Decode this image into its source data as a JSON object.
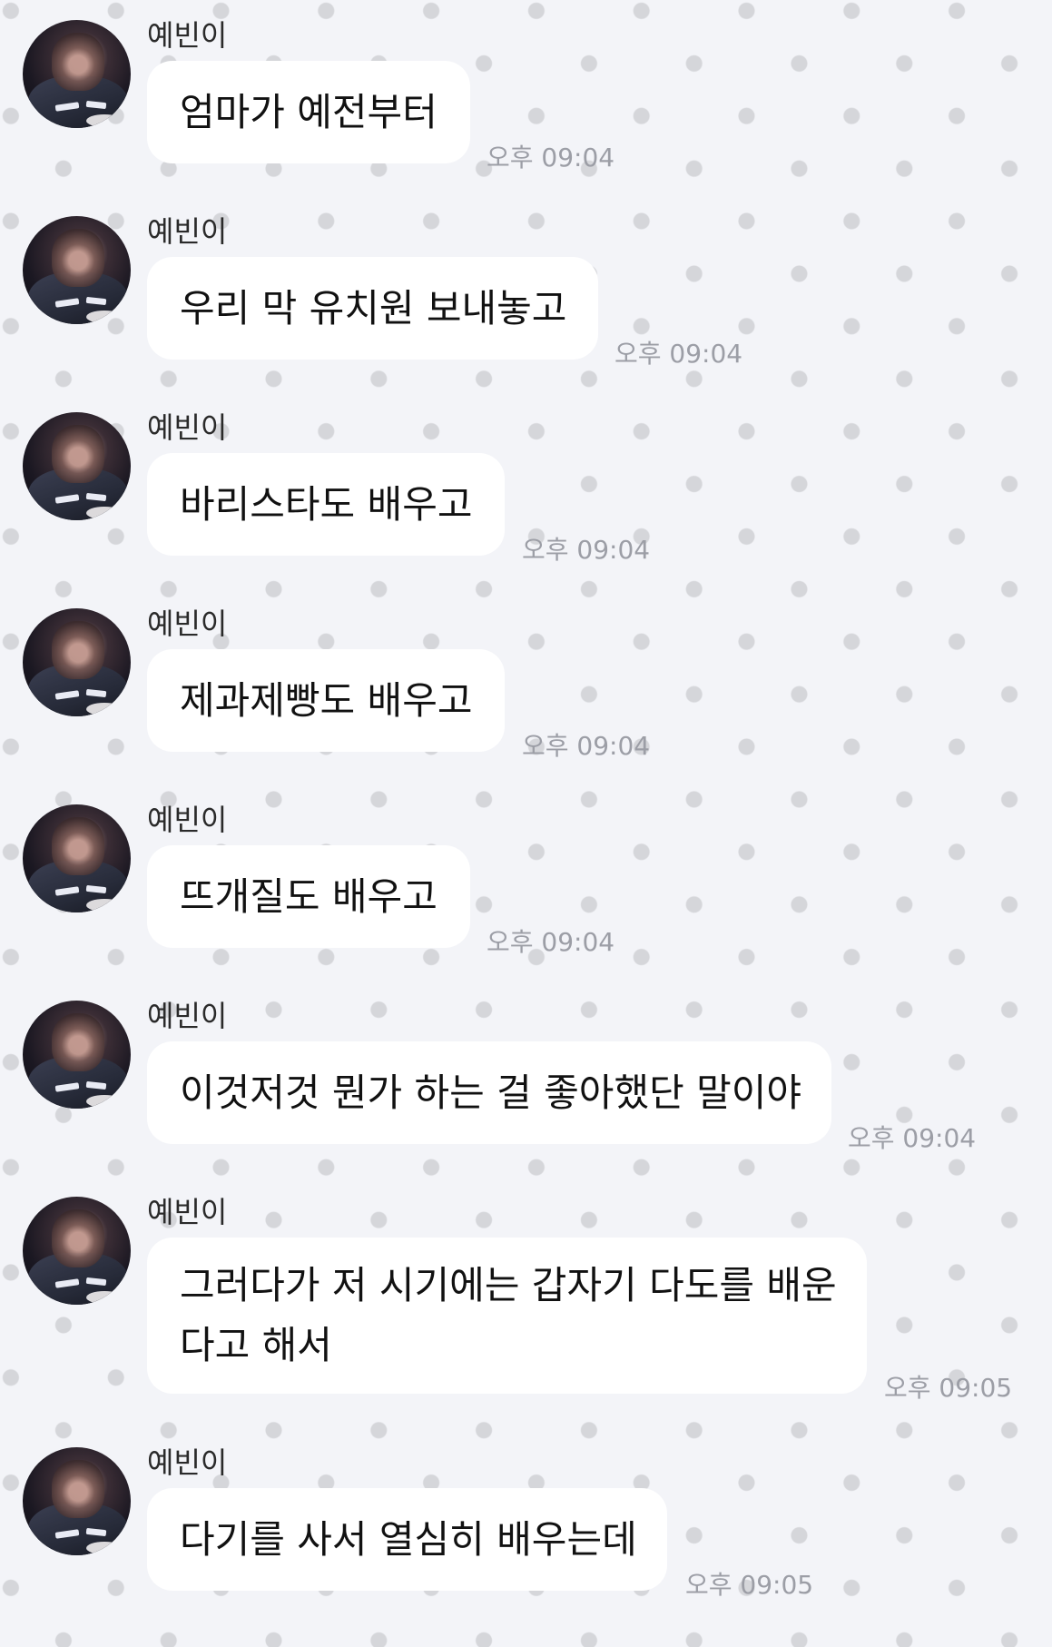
{
  "sender": "예빈이",
  "messages": [
    {
      "lines": [
        "엄마가 예전부터"
      ],
      "time": "오후 09:04"
    },
    {
      "lines": [
        "우리 막 유치원 보내놓고"
      ],
      "time": "오후 09:04"
    },
    {
      "lines": [
        "바리스타도 배우고"
      ],
      "time": "오후 09:04"
    },
    {
      "lines": [
        "제과제빵도 배우고"
      ],
      "time": "오후 09:04"
    },
    {
      "lines": [
        "뜨개질도 배우고"
      ],
      "time": "오후 09:04"
    },
    {
      "lines": [
        "이것저것 뭔가 하는 걸 좋아했단 말이야"
      ],
      "time": "오후 09:04"
    },
    {
      "lines": [
        "그러다가 저 시기에는 갑자기 다도를 배운",
        "다고 해서"
      ],
      "time": "오후 09:05"
    },
    {
      "lines": [
        "다기를 사서 열심히 배우는데"
      ],
      "time": "오후 09:05"
    }
  ]
}
